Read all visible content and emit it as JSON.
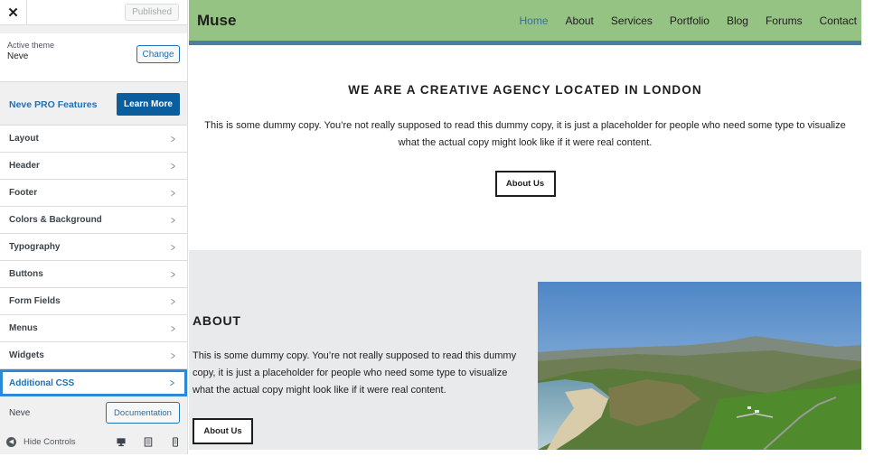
{
  "sidebar": {
    "close_label": "✕",
    "published_label": "Published",
    "active_theme_label": "Active theme",
    "theme_name": "Neve",
    "change_label": "Change",
    "pro_label": "Neve PRO Features",
    "learn_more_label": "Learn More",
    "items": [
      {
        "label": "Layout"
      },
      {
        "label": "Header"
      },
      {
        "label": "Footer"
      },
      {
        "label": "Colors & Background"
      },
      {
        "label": "Typography"
      },
      {
        "label": "Buttons"
      },
      {
        "label": "Form Fields"
      },
      {
        "label": "Menus"
      },
      {
        "label": "Widgets"
      },
      {
        "label": "Additional CSS"
      }
    ],
    "active_item": "Additional CSS",
    "neve_label": "Neve",
    "documentation_label": "Documentation",
    "hide_controls_label": "Hide Controls"
  },
  "site": {
    "logo": "Muse",
    "nav": [
      "Home",
      "About",
      "Services",
      "Portfolio",
      "Blog",
      "Forums",
      "Contact"
    ],
    "current_nav": "Home",
    "hero": {
      "title": "WE ARE A CREATIVE AGENCY LOCATED IN LONDON",
      "text": "This is some dummy copy. You’re not really supposed to read this dummy copy, it is just a placeholder for people who need some type to visualize what the actual copy might look like if it were real content.",
      "button": "About Us"
    },
    "about": {
      "title": "ABOUT",
      "text": "This is some dummy copy. You’re not really supposed to read this dummy copy, it is just a placeholder for people who need some type to visualize what the actual copy might look like if it were real content.",
      "button": "About Us"
    }
  },
  "colors": {
    "header_bg": "#95c384",
    "header_border": "#4b7ea3",
    "primary_blue": "#2271b1",
    "learn_more_bg": "#0a5e9e",
    "active_outline": "#2b8ad8"
  },
  "icons": {
    "close": "close-icon",
    "chevron": "chevron-right-icon",
    "hide": "collapse-left-icon",
    "desktop": "desktop-icon",
    "tablet": "tablet-icon",
    "mobile": "mobile-icon"
  }
}
